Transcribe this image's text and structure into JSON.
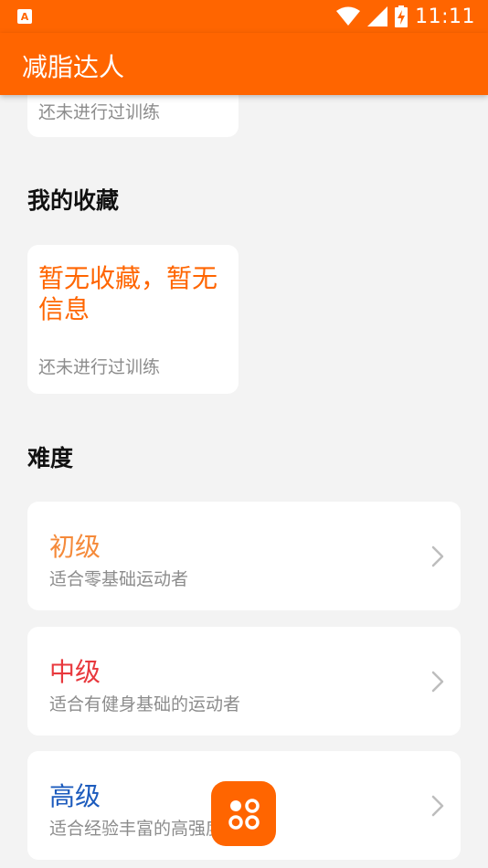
{
  "status_bar": {
    "time": "11:11"
  },
  "app_bar": {
    "title": "减脂达人"
  },
  "history_card": {
    "subtitle": "还未进行过训练"
  },
  "favorites": {
    "section_title": "我的收藏",
    "card_title": "暂无收藏，暂无信息",
    "card_subtitle": "还未进行过训练"
  },
  "difficulty": {
    "section_title": "难度",
    "levels": [
      {
        "name": "初级",
        "desc": "适合零基础运动者",
        "color": "#f58a3a"
      },
      {
        "name": "中级",
        "desc": "适合有健身基础的运动者",
        "color": "#e8383d"
      },
      {
        "name": "高级",
        "desc": "适合经验丰富的高强度运动者",
        "color": "#1c5bbd"
      }
    ]
  },
  "colors": {
    "accent": "#ff6500"
  }
}
